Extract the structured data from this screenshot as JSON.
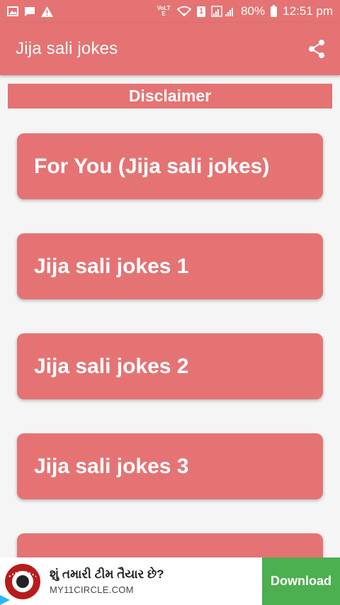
{
  "status_bar": {
    "network_label": "VoLTE",
    "sim_label": "1",
    "battery": "80%",
    "time": "12:51 pm"
  },
  "app_bar": {
    "title": "Jija sali jokes",
    "share_icon": "share-icon"
  },
  "disclaimer": {
    "label": "Disclaimer"
  },
  "menu": {
    "items": [
      {
        "label": "For You (Jija sali jokes)"
      },
      {
        "label": "Jija sali jokes 1"
      },
      {
        "label": "Jija sali jokes 2"
      },
      {
        "label": "Jija sali jokes 3"
      },
      {
        "label": ""
      }
    ]
  },
  "ad": {
    "headline": "શું તમારી ટીમ તૈયાર છે?",
    "url": "MY11CIRCLE.COM",
    "cta": "Download"
  },
  "colors": {
    "primary": "#e57373",
    "background": "#f5f5f5",
    "cta": "#4caf50"
  }
}
